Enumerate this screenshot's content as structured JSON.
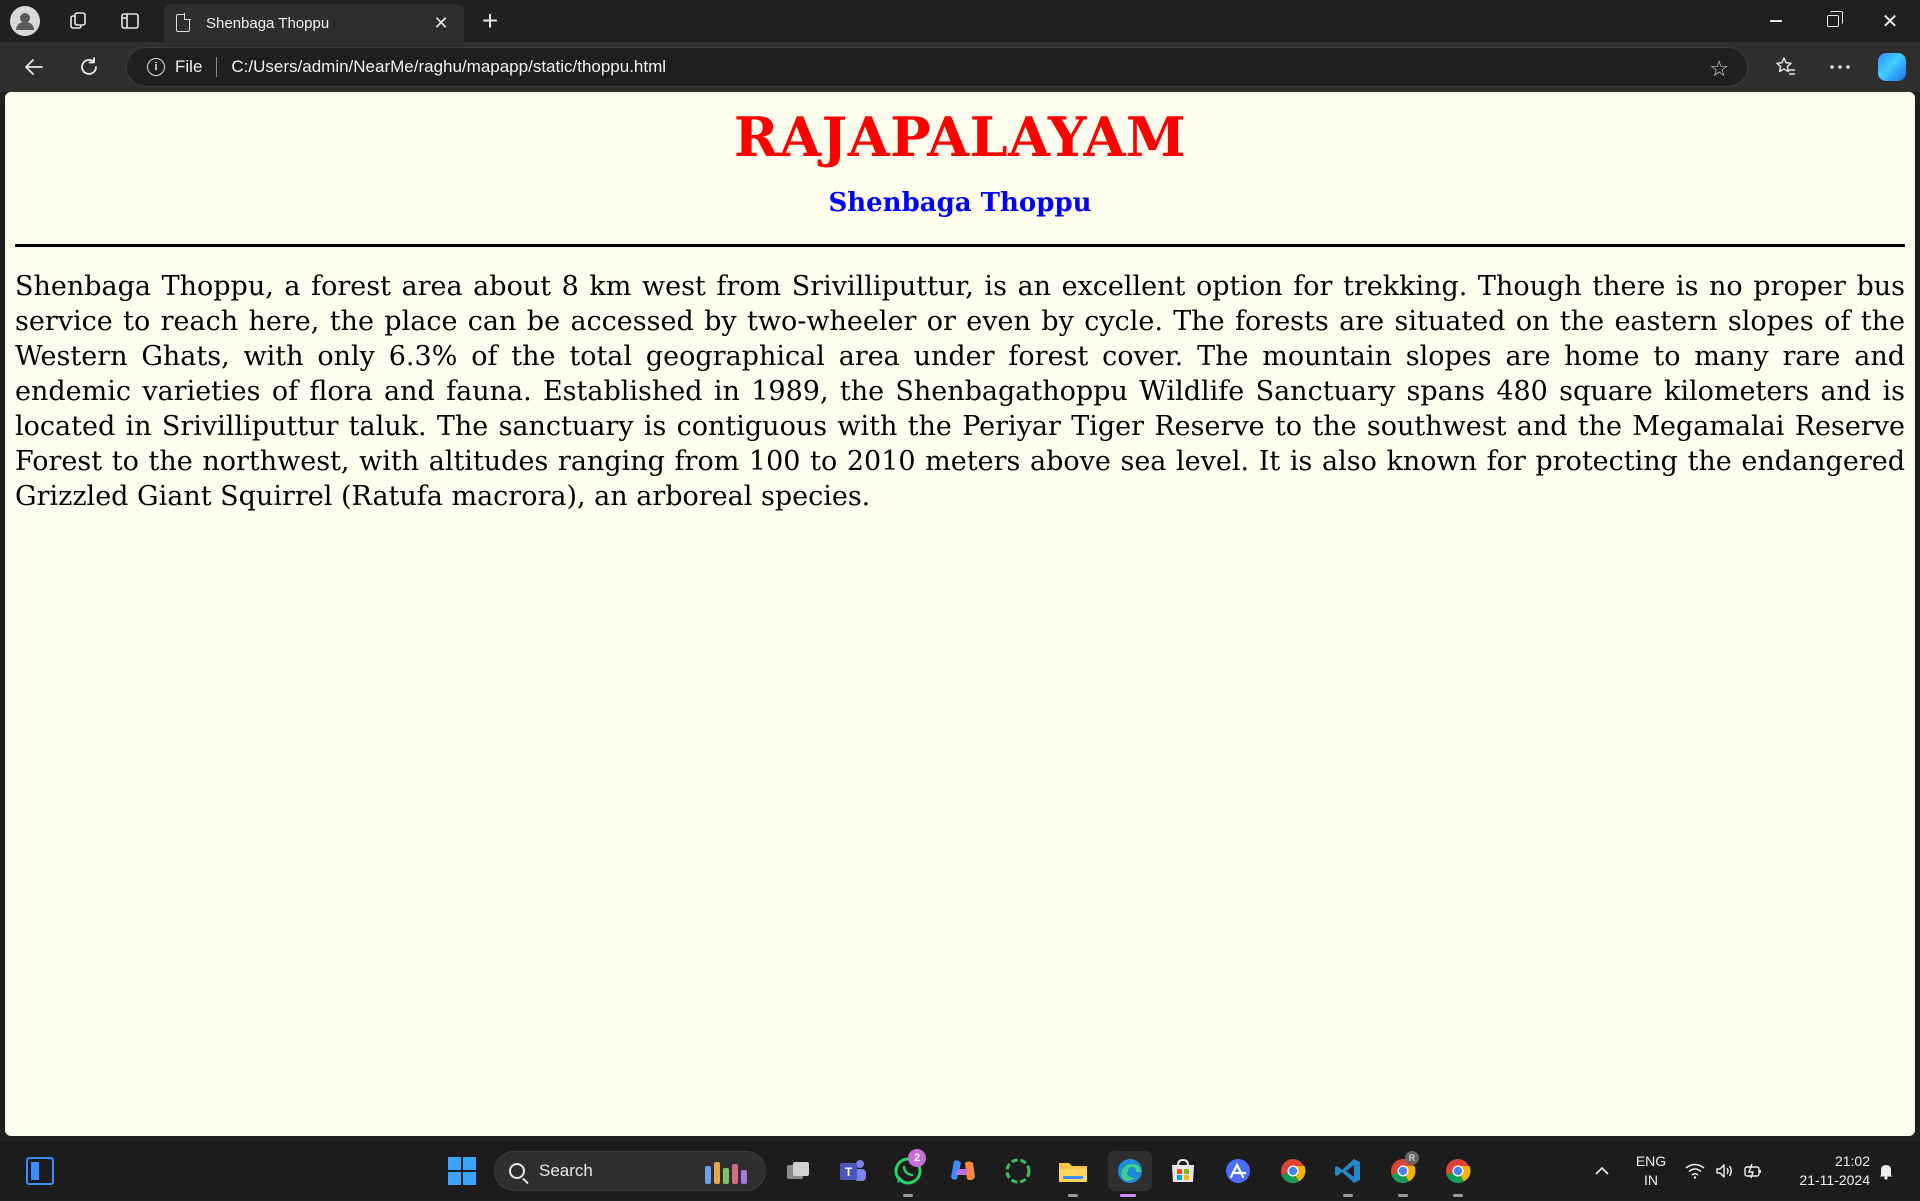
{
  "browser": {
    "tab_title": "Shenbaga Thoppu",
    "tab_close": "✕",
    "new_tab": "+",
    "address": {
      "scheme_label": "File",
      "url": "C:/Users/admin/NearMe/raghu/mapapp/static/thoppu.html"
    },
    "window_controls": {
      "close": "✕"
    }
  },
  "page": {
    "heading": "RAJAPALAYAM",
    "subheading": "Shenbaga Thoppu",
    "paragraph": "Shenbaga Thoppu, a forest area about 8 km west from Srivilliputtur, is an excellent option for trekking. Though there is no proper bus service to reach here, the place can be accessed by two-wheeler or even by cycle. The forests are situated on the eastern slopes of the Western Ghats, with only 6.3% of the total geographical area under forest cover. The mountain slopes are home to many rare and endemic varieties of flora and fauna. Established in 1989, the Shenbagathoppu Wildlife Sanctuary spans 480 square kilometers and is located in Srivilliputtur taluk. The sanctuary is contiguous with the Periyar Tiger Reserve to the southwest and the Megamalai Reserve Forest to the northwest, with altitudes ranging from 100 to 2010 meters above sea level. It is also known for protecting the endangered Grizzled Giant Squirrel (Ratufa macrora), an arboreal species.",
    "colors": {
      "background": "#fffeee",
      "heading": "#ff0000",
      "subheading": "#0000ff"
    }
  },
  "taskbar": {
    "search_label": "Search",
    "whatsapp_badge": "2",
    "chrome_profile_badge": "R",
    "apps": [
      "widgets-icon",
      "start-icon",
      "task-view-icon",
      "teams-icon",
      "whatsapp-icon",
      "copilot-icon",
      "sync-icon",
      "file-explorer-icon",
      "edge-icon",
      "store-icon",
      "app-icon",
      "chrome-icon",
      "vscode-icon",
      "chrome-profile-icon",
      "chrome-icon-2"
    ],
    "tray": {
      "language_line1": "ENG",
      "language_line2": "IN",
      "time": "21:02",
      "date": "21-11-2024"
    }
  }
}
